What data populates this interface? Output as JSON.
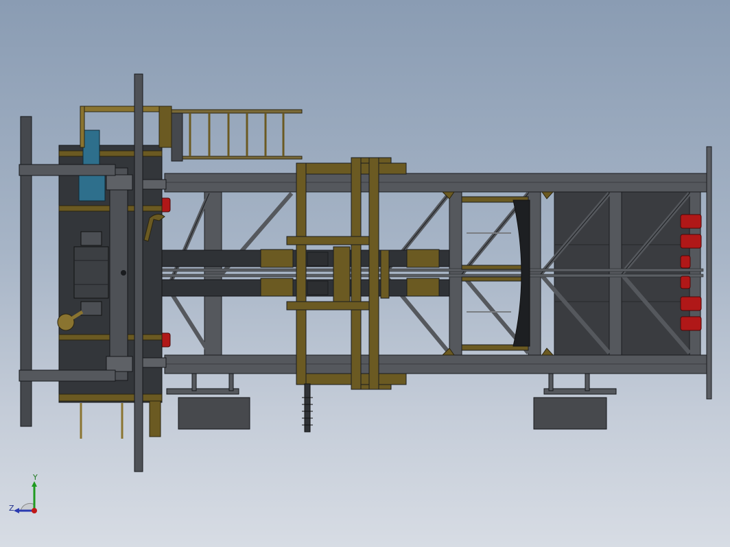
{
  "viewport": {
    "background_top": "#8a9cb3",
    "background_bottom": "#d7dce4"
  },
  "model": {
    "colors": {
      "steel": "#4a4d52",
      "steel_dark": "#2f3236",
      "steel_edge": "#1a1c1f",
      "panel": "#3a3c40",
      "olive": "#6b5a22",
      "olive_light": "#8a7430",
      "red": "#b01818",
      "motor_blue": "#2e6f8c"
    }
  },
  "triad": {
    "icon": "orientation-triad-icon",
    "y_label": "Y",
    "z_label": "Z",
    "y_color": "#1f9a1f",
    "z_color": "#2a3ab0",
    "x_color": "#c01818"
  }
}
